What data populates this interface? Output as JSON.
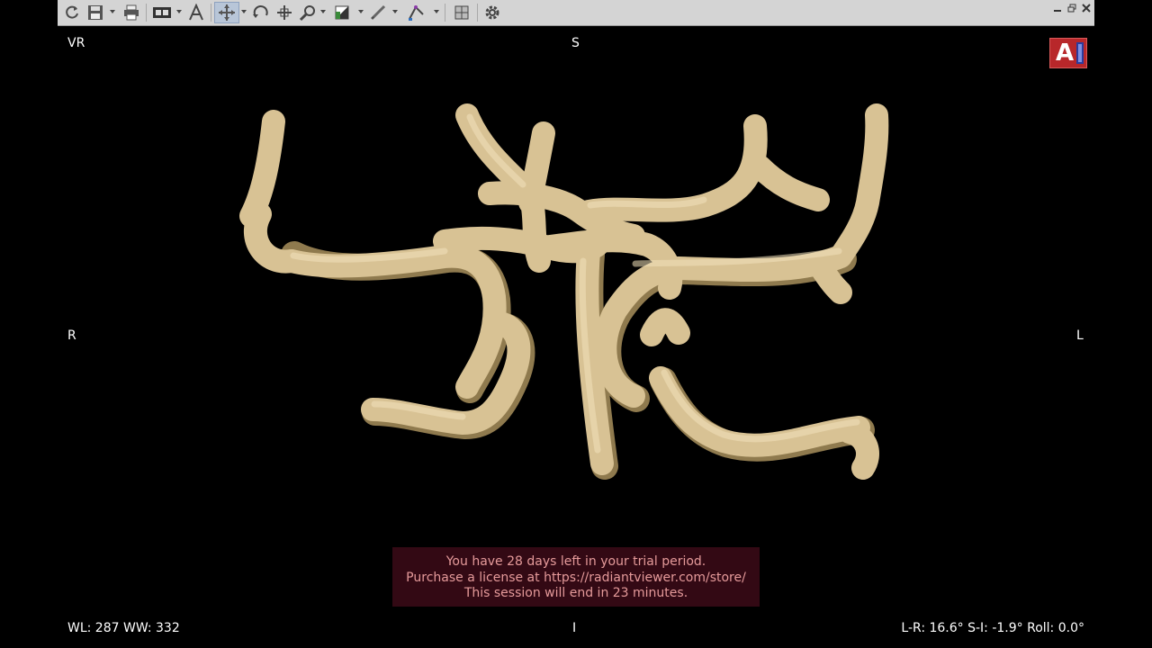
{
  "toolbar": {
    "buttons": [
      {
        "name": "refresh-button",
        "icon": "refresh-icon"
      },
      {
        "name": "save-button",
        "icon": "floppy-disk-icon"
      },
      {
        "name": "print-button",
        "icon": "printer-icon"
      },
      {
        "name": "display-mode-button",
        "icon": "film-icon"
      },
      {
        "name": "annotation-text-button",
        "icon": "letter-a-icon"
      },
      {
        "name": "pan-tool-button",
        "icon": "move-icon",
        "active": true
      },
      {
        "name": "rotate-button",
        "icon": "rotate-icon"
      },
      {
        "name": "crosshair-button",
        "icon": "crosshair-icon"
      },
      {
        "name": "zoom-button",
        "icon": "magnifier-icon"
      },
      {
        "name": "window-level-button",
        "icon": "contrast-icon"
      },
      {
        "name": "measure-button",
        "icon": "ruler-pencil-icon"
      },
      {
        "name": "angle-button",
        "icon": "angle-icon"
      },
      {
        "name": "layout-button",
        "icon": "grid-icon"
      },
      {
        "name": "settings-button",
        "icon": "gear-icon"
      }
    ]
  },
  "window_controls": [
    "minimize-icon",
    "restore-icon",
    "close-icon"
  ],
  "overlay": {
    "top_left": "VR",
    "top_center": "S",
    "left_middle": "R",
    "right_middle": "L",
    "bottom_left": "WL: 287 WW: 332",
    "bottom_center": "I",
    "bottom_right": "L-R: 16.6° S-I: -1.9° Roll: 0.0°"
  },
  "logo": {
    "letter": "A"
  },
  "trial": {
    "line1": "You have 28 days left in your trial period.",
    "line2": "Purchase a license at https://radiantviewer.com/store/",
    "line3": "This session will end in 23 minutes."
  },
  "colors": {
    "background": "#000000",
    "vessel": "#d8c294",
    "vessel_shadow": "#8f7a4e",
    "trial_bg": "#330914",
    "trial_text": "#e59a9a",
    "toolbar_bg": "#d4d4d4"
  }
}
